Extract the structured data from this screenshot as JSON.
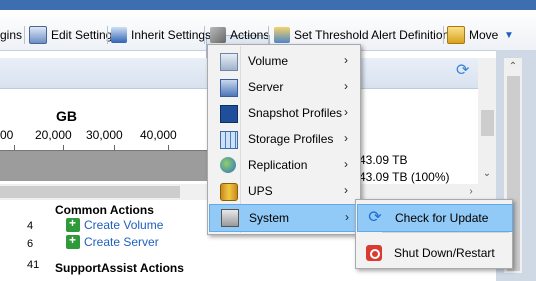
{
  "toolbar": {
    "items": [
      {
        "label": "gins",
        "icon": "plugins-icon"
      },
      {
        "label": "Edit Settings",
        "icon": "edit-settings-icon"
      },
      {
        "label": "Inherit Settings",
        "icon": "inherit-settings-icon"
      },
      {
        "label": "Actions",
        "icon": "actions-tools-icon"
      },
      {
        "label": "Set Threshold Alert Definitions",
        "icon": "threshold-alert-icon"
      },
      {
        "label": "Move",
        "icon": "move-folder-icon"
      }
    ],
    "overflow_icon": "chevron-down-icon"
  },
  "chart": {
    "unit": "GB",
    "ticks": [
      "00",
      "20,000",
      "30,000",
      "40,000"
    ]
  },
  "capacity": {
    "line1": "43.09 TB",
    "line2": "43.09 TB  (100%)"
  },
  "counts": [
    "4",
    "6",
    "41"
  ],
  "common_actions": {
    "title": "Common Actions",
    "links": [
      "Create Volume",
      "Create Server"
    ]
  },
  "support_actions": {
    "title": "SupportAssist Actions"
  },
  "actions_menu": {
    "items": [
      {
        "label": "Volume",
        "icon": "volume-icon",
        "submenu": true
      },
      {
        "label": "Server",
        "icon": "server-icon",
        "submenu": true
      },
      {
        "label": "Snapshot Profiles",
        "icon": "snapshot-profiles-icon",
        "submenu": true
      },
      {
        "label": "Storage Profiles",
        "icon": "storage-profiles-icon",
        "submenu": true
      },
      {
        "label": "Replication",
        "icon": "replication-icon",
        "submenu": true
      },
      {
        "label": "UPS",
        "icon": "ups-icon",
        "submenu": true
      },
      {
        "label": "System",
        "icon": "system-icon",
        "submenu": true,
        "highlighted": true
      }
    ],
    "arrow": "›"
  },
  "system_submenu": {
    "items": [
      {
        "label": "Check for Update",
        "icon": "check-update-icon",
        "highlighted": true
      },
      {
        "label": "Shut Down/Restart",
        "icon": "shutdown-restart-icon"
      }
    ]
  },
  "colors": {
    "highlight": "#91c9f7",
    "menu_bg": "#f2f2f2",
    "link": "#1f5fbf"
  }
}
